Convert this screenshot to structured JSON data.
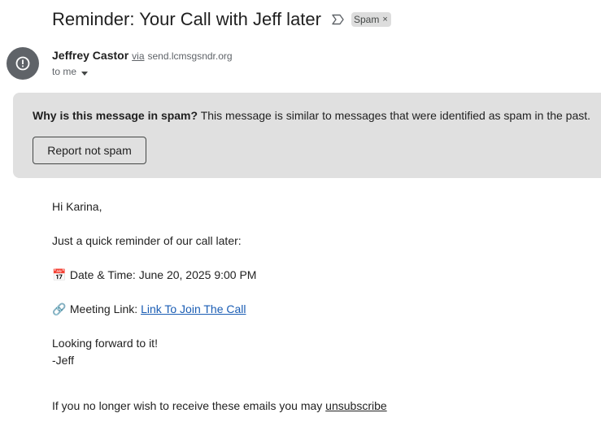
{
  "email": {
    "subject": "Reminder: Your Call with Jeff later",
    "label_chip": "Spam",
    "label_chip_close": "×",
    "sender": {
      "name": "Jeffrey Castor",
      "via": "via",
      "domain": "send.lcmsgsndr.org",
      "recipient": "to me"
    }
  },
  "spam_banner": {
    "question": "Why is this message in spam?",
    "explanation": "This message is similar to messages that were identified as spam in the past.",
    "button_label": "Report not spam"
  },
  "body": {
    "greeting": "Hi Karina,",
    "intro": "Just a quick reminder of our call later:",
    "datetime_emoji": "📅",
    "datetime_text": "Date & Time: June 20, 2025 9:00 PM",
    "link_emoji": "🔗",
    "link_prefix": "Meeting Link:",
    "link_text": "Link To Join The Call",
    "closing_line1": "Looking forward to it!",
    "closing_line2": "-Jeff",
    "unsubscribe_prefix": "If you no longer wish to receive these emails you may",
    "unsubscribe_link": "unsubscribe"
  },
  "colors": {
    "banner_bg": "#e0e0e0",
    "avatar_bg": "#5f6368",
    "link": "#1a5db4"
  }
}
